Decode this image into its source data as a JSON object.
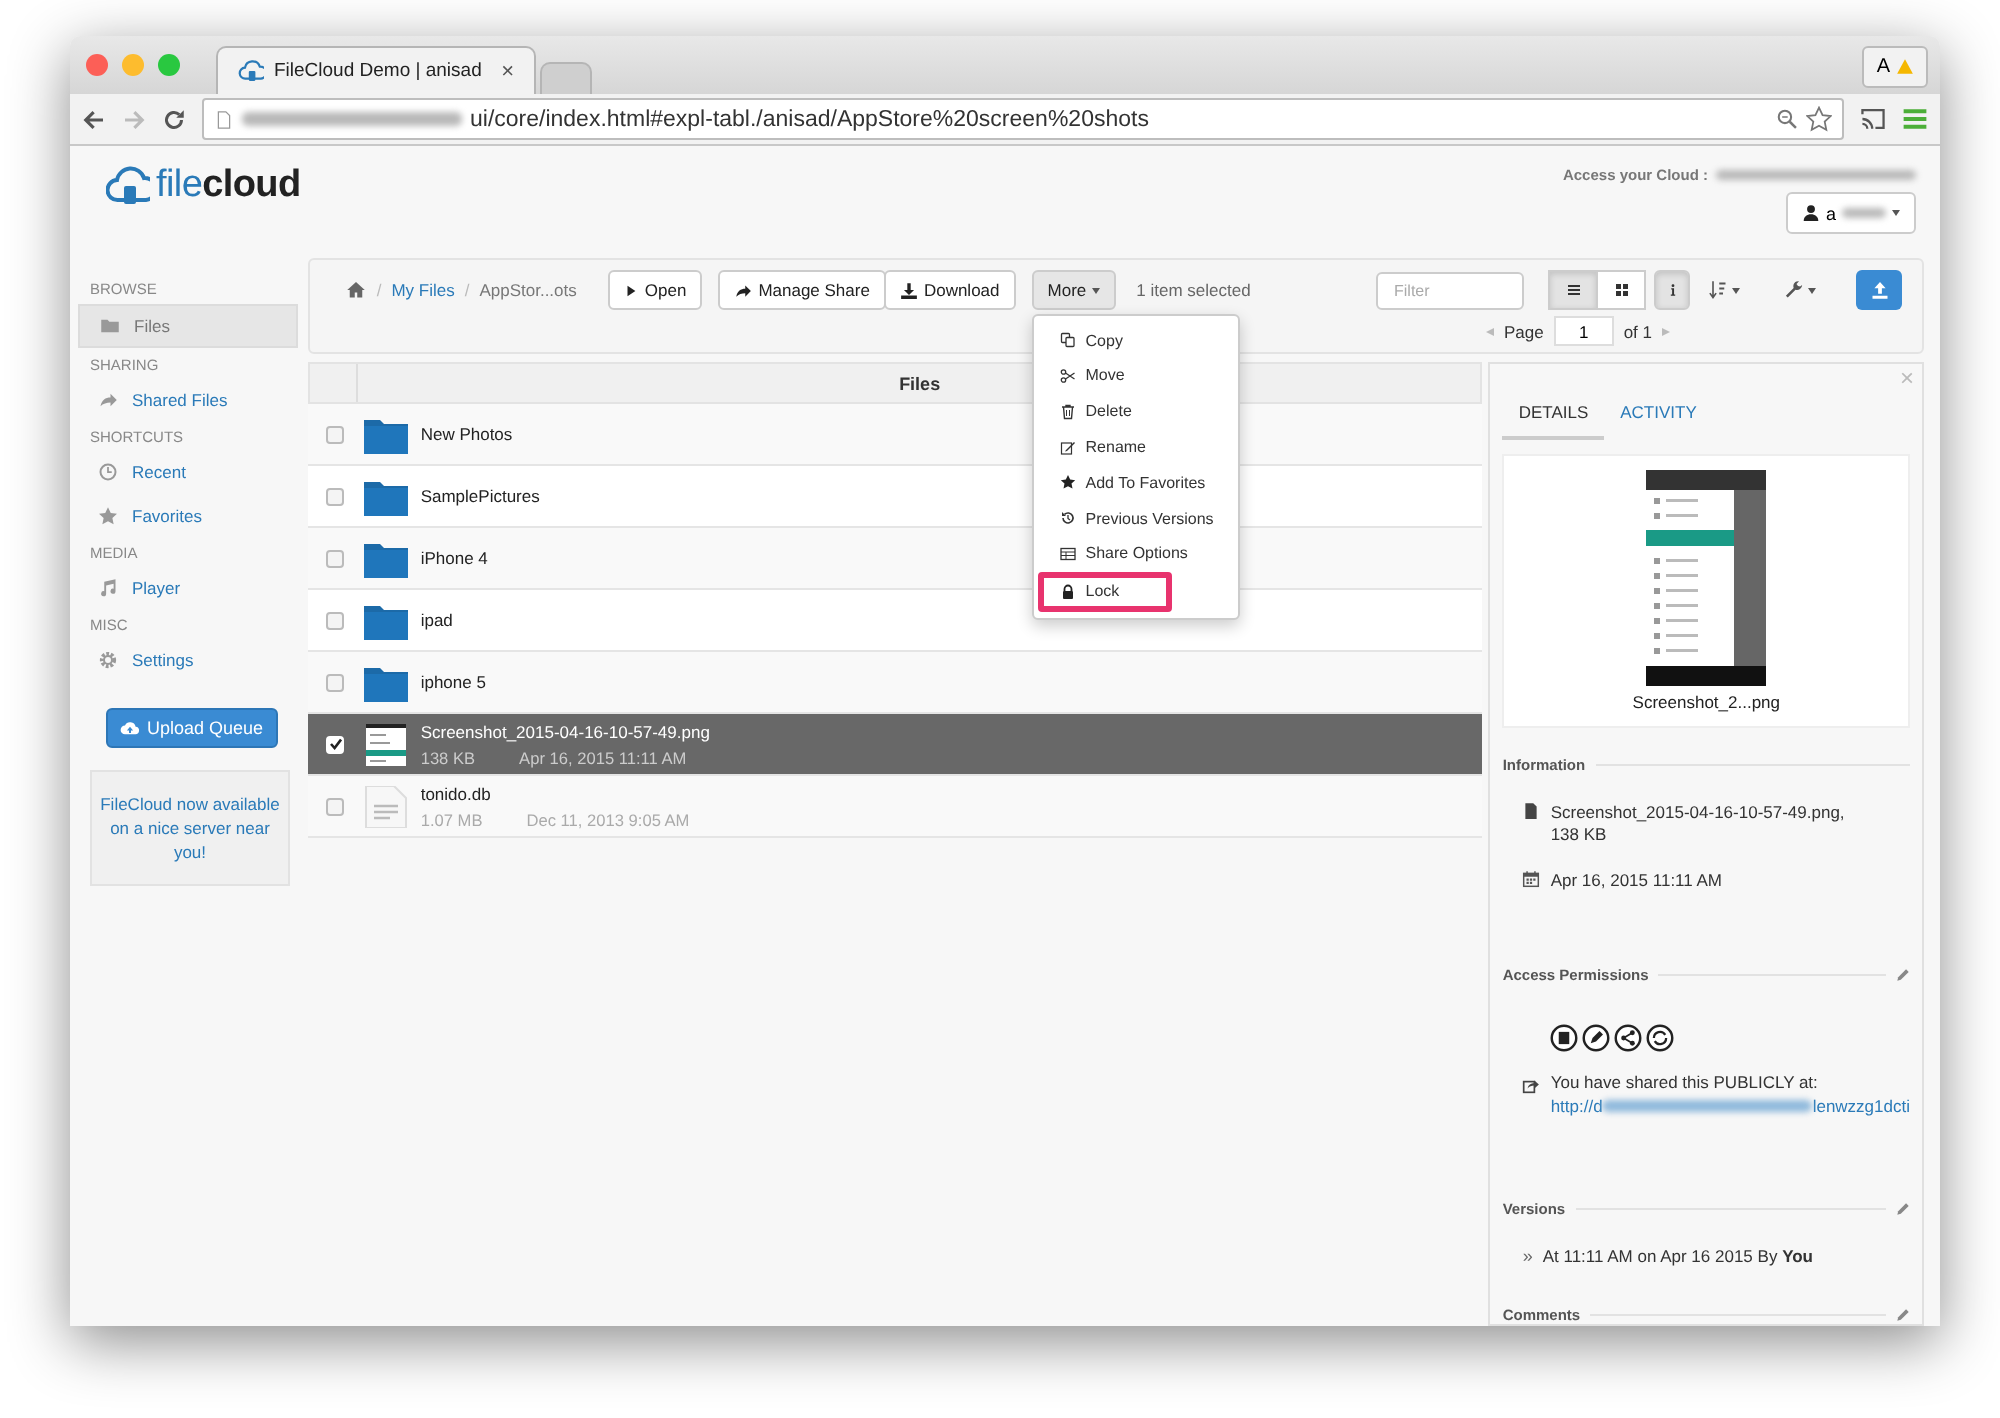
{
  "browser": {
    "tabs": [
      {
        "title": "FileCloud Demo | anisad",
        "close": "×",
        "selected": true
      },
      {
        "selected": false
      }
    ],
    "profile": "A",
    "url": "ui/core/index.html#expl-tabl./anisad/AppStore%20screen%20shots"
  },
  "header": {
    "logo": "file**cloud**",
    "access_label": "Access your Cloud :",
    "user": "a"
  },
  "sidebar": {
    "sections": [
      {
        "heading": "BROWSE",
        "items": [
          {
            "label": "Files",
            "selected": true
          }
        ]
      },
      {
        "heading": "SHARING",
        "items": [
          {
            "label": "Shared Files",
            "selected": false
          }
        ]
      },
      {
        "heading": "SHORTCUTS",
        "items": [
          {
            "label": "Recent",
            "selected": false
          },
          {
            "label": "Favorites",
            "selected": false
          }
        ]
      },
      {
        "heading": "MEDIA",
        "items": [
          {
            "label": "Player",
            "selected": false
          }
        ]
      },
      {
        "heading": "MISC",
        "items": [
          {
            "label": "Settings",
            "selected": false
          }
        ]
      }
    ],
    "upload_button": "Upload Queue",
    "promo": "FileCloud now available on a nice server near you!"
  },
  "toolbar": {
    "breadcrumb": [
      {
        "label": "My Files",
        "kind": "link"
      },
      {
        "label": "AppStor...ots",
        "kind": "current"
      }
    ],
    "separator": "/",
    "buttons": [
      "Open",
      "Manage Share",
      "Download"
    ],
    "more": "More",
    "selection": "1 item selected",
    "filter_placeholder": "Filter",
    "views": [
      {
        "selected": true
      },
      {
        "selected": false
      }
    ],
    "info_selected": true,
    "page_label": "Page",
    "page": "1",
    "page_total": "of 1"
  },
  "menu": {
    "items": [
      {
        "label": "Copy",
        "selected": false
      },
      {
        "label": "Move",
        "selected": false
      },
      {
        "label": "Delete",
        "selected": false
      },
      {
        "label": "Rename",
        "selected": false
      },
      {
        "label": "Add To Favorites",
        "selected": false
      },
      {
        "label": "Previous Versions",
        "selected": false
      },
      {
        "label": "Share Options",
        "selected": false
      },
      {
        "label": "Lock",
        "selected": true
      }
    ]
  },
  "files": {
    "header": "Files",
    "rows": [
      {
        "name": "New Photos",
        "kind": "folder",
        "checked": false,
        "selected": false
      },
      {
        "name": "SamplePictures",
        "kind": "folder",
        "checked": false,
        "selected": false
      },
      {
        "name": "iPhone 4",
        "kind": "folder",
        "checked": false,
        "selected": false
      },
      {
        "name": "ipad",
        "kind": "folder",
        "checked": false,
        "selected": false
      },
      {
        "name": "iphone 5",
        "kind": "folder",
        "checked": false,
        "selected": false
      },
      {
        "name": "Screenshot_2015-04-16-10-57-49.png",
        "size": "138 KB",
        "date": "Apr 16, 2015 11:11 AM",
        "kind": "image",
        "checked": true,
        "selected": true
      },
      {
        "name": "tonido.db",
        "size": "1.07 MB",
        "date": "Dec 11, 2013 9:05 AM",
        "kind": "file",
        "checked": false,
        "selected": false
      }
    ]
  },
  "details": {
    "close": "×",
    "tabs": [
      {
        "label": "DETAILS",
        "selected": true
      },
      {
        "label": "ACTIVITY",
        "selected": false
      }
    ],
    "preview_caption": "Screenshot_2...png",
    "sections": [
      {
        "kind": "info",
        "heading": "Information",
        "editable": false,
        "file": "Screenshot_2015-04-16-10-57-49.png, 138 KB",
        "date": "Apr 16, 2015 11:11 AM"
      },
      {
        "kind": "permissions",
        "heading": "Access Permissions",
        "editable": true,
        "share_text": "You have shared this PUBLICLY at:",
        "link_start": "http://d",
        "link_end": "lenwzzg1dcti"
      },
      {
        "kind": "versions",
        "heading": "Versions",
        "editable": true,
        "bullet": "»",
        "entries": [
          "At 11:11 AM on Apr 16 2015 By **You**"
        ]
      },
      {
        "kind": "comments",
        "heading": "Comments",
        "editable": true
      }
    ]
  }
}
